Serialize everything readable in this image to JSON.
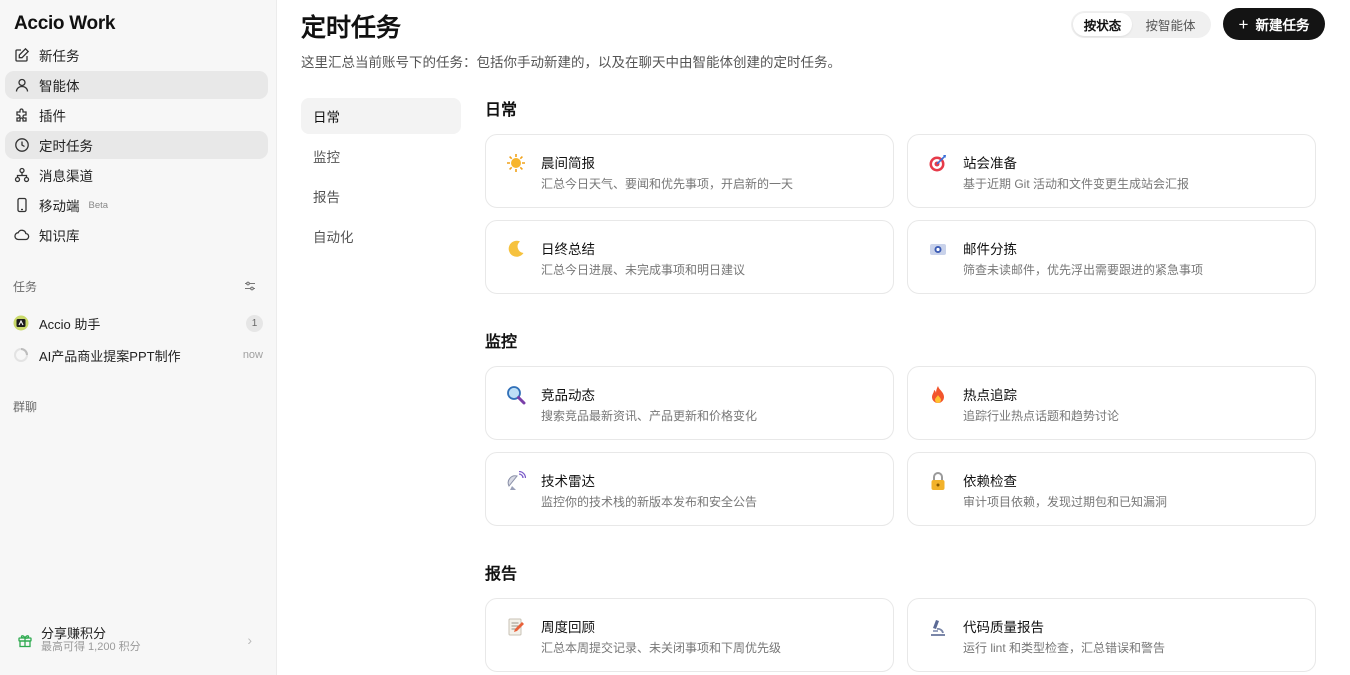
{
  "app": {
    "name": "Accio Work"
  },
  "sidebar": {
    "nav": [
      {
        "label": "新任务",
        "icon": "edit-icon"
      },
      {
        "label": "智能体",
        "icon": "user-icon"
      },
      {
        "label": "插件",
        "icon": "puzzle-icon"
      },
      {
        "label": "定时任务",
        "icon": "clock-icon"
      },
      {
        "label": "消息渠道",
        "icon": "channel-icon"
      },
      {
        "label": "移动端",
        "icon": "phone-icon",
        "badge": "Beta"
      },
      {
        "label": "知识库",
        "icon": "cloud-icon"
      }
    ],
    "tasks_label": "任务",
    "tasks": [
      {
        "label": "Accio 助手",
        "count": "1"
      },
      {
        "label": "AI产品商业提案PPT制作",
        "time": "now"
      }
    ],
    "groups_label": "群聊",
    "share": {
      "title": "分享赚积分",
      "subtitle": "最高可得 1,200 积分"
    }
  },
  "main": {
    "title": "定时任务",
    "description": "这里汇总当前账号下的任务：包括你手动新建的，以及在聊天中由智能体创建的定时任务。",
    "view_toggle": {
      "by_status": "按状态",
      "by_agent": "按智能体",
      "selected": "按状态"
    },
    "new_task_button": "新建任务",
    "categories": [
      "日常",
      "监控",
      "报告",
      "自动化"
    ],
    "selected_category": "日常",
    "sections": [
      {
        "title": "日常",
        "cards": [
          {
            "title": "晨间简报",
            "desc": "汇总今日天气、要闻和优先事项，开启新的一天",
            "icon": "sun-icon"
          },
          {
            "title": "站会准备",
            "desc": "基于近期 Git 活动和文件变更生成站会汇报",
            "icon": "target-icon"
          },
          {
            "title": "日终总结",
            "desc": "汇总今日进展、未完成事项和明日建议",
            "icon": "moon-icon"
          },
          {
            "title": "邮件分拣",
            "desc": "筛查未读邮件，优先浮出需要跟进的紧急事项",
            "icon": "mailbox-icon"
          }
        ]
      },
      {
        "title": "监控",
        "cards": [
          {
            "title": "竞品动态",
            "desc": "搜索竞品最新资讯、产品更新和价格变化",
            "icon": "magnifier-icon"
          },
          {
            "title": "热点追踪",
            "desc": "追踪行业热点话题和趋势讨论",
            "icon": "fire-icon"
          },
          {
            "title": "技术雷达",
            "desc": "监控你的技术栈的新版本发布和安全公告",
            "icon": "satellite-icon"
          },
          {
            "title": "依赖检查",
            "desc": "审计项目依赖，发现过期包和已知漏洞",
            "icon": "lock-icon"
          }
        ]
      },
      {
        "title": "报告",
        "cards": [
          {
            "title": "周度回顾",
            "desc": "汇总本周提交记录、未关闭事项和下周优先级",
            "icon": "memo-icon"
          },
          {
            "title": "代码质量报告",
            "desc": "运行 lint 和类型检查，汇总错误和警告",
            "icon": "microscope-icon"
          }
        ]
      }
    ]
  },
  "colors": {
    "sidebar_bg": "#f7f7f7",
    "active_nav": "#e8e8e8",
    "primary_button": "#141414",
    "card_border": "#e8e8e8"
  }
}
